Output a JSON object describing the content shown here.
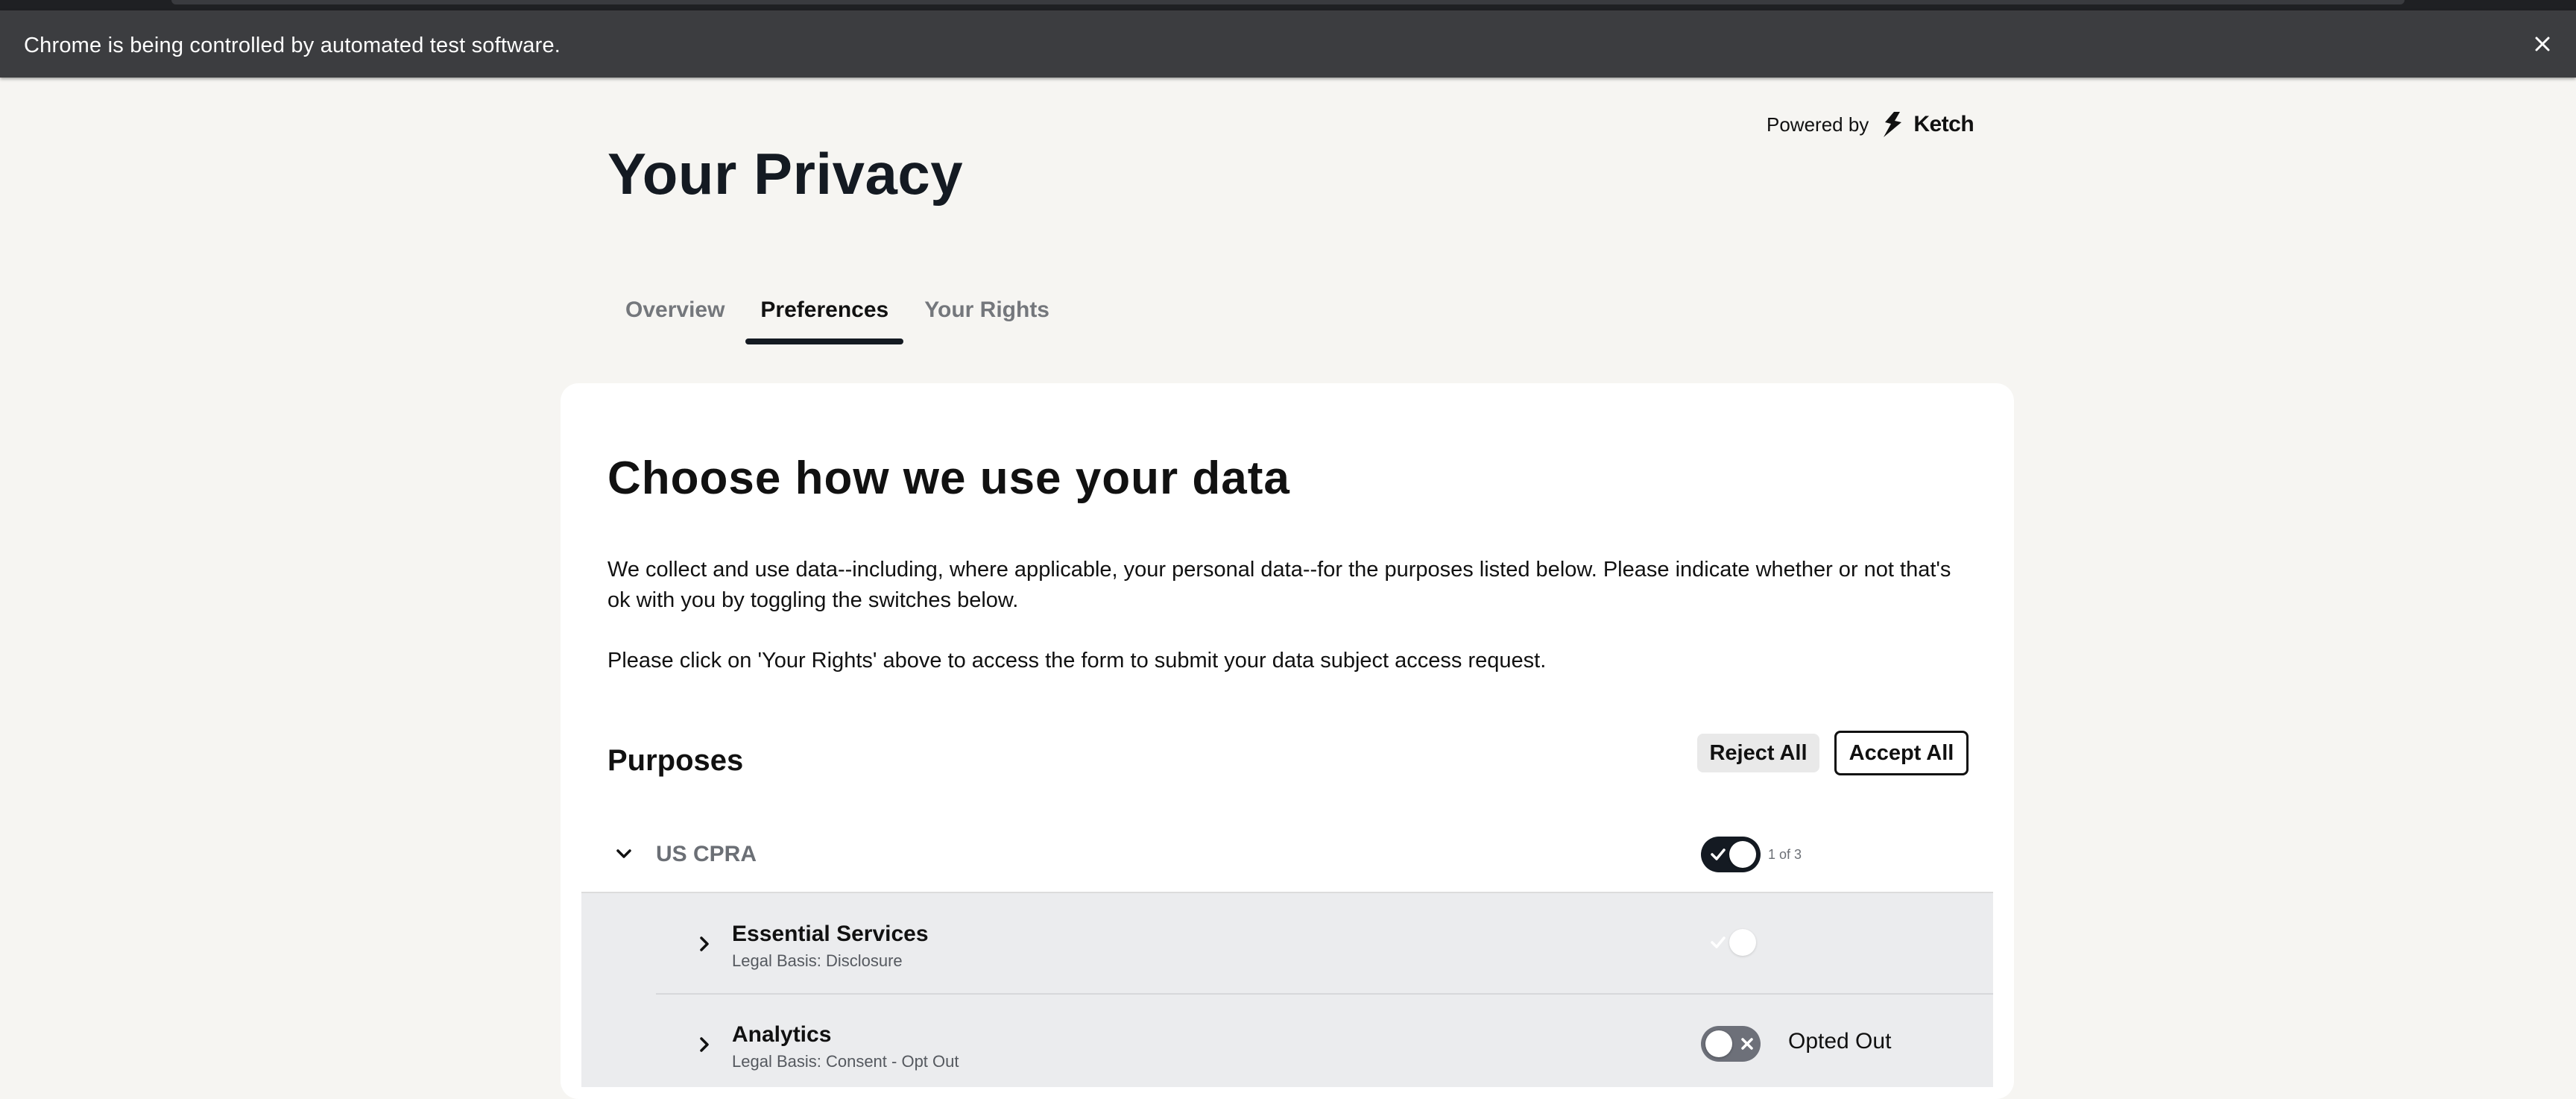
{
  "browser": {
    "infobar_message": "Chrome is being controlled by automated test software.",
    "close_icon": "close-icon"
  },
  "header": {
    "powered_by": "Powered by",
    "brand_name": "Ketch",
    "title": "Your Privacy"
  },
  "tabs": [
    {
      "label": "Overview",
      "active": false
    },
    {
      "label": "Preferences",
      "active": true
    },
    {
      "label": "Your Rights",
      "active": false
    }
  ],
  "card": {
    "heading": "Choose how we use your data",
    "paragraph1": "We collect and use data--including, where applicable, your personal data--for the purposes listed below. Please indicate whether or not that's ok with you by toggling the switches below.",
    "paragraph2": "Please click on 'Your Rights' above to access the form to submit your data subject access request.",
    "purposes_heading": "Purposes",
    "reject_all": "Reject All",
    "accept_all": "Accept All"
  },
  "group": {
    "name": "US CPRA",
    "count": "1 of 3",
    "toggle_on": true,
    "expanded": true
  },
  "purposes": [
    {
      "title": "Essential Services",
      "legal_basis": "Legal Basis: Disclosure",
      "status": "",
      "toggle": "disabled-on"
    },
    {
      "title": "Analytics",
      "legal_basis": "Legal Basis: Consent - Opt Out",
      "status": "Opted Out",
      "toggle": "off"
    }
  ],
  "colors": {
    "page_bg": "#f6f5f2",
    "infobar_bg": "#3c3d40",
    "accent_dark": "#141a22",
    "muted_text": "#6b6f75",
    "purpose_bg": "#ebecee"
  }
}
